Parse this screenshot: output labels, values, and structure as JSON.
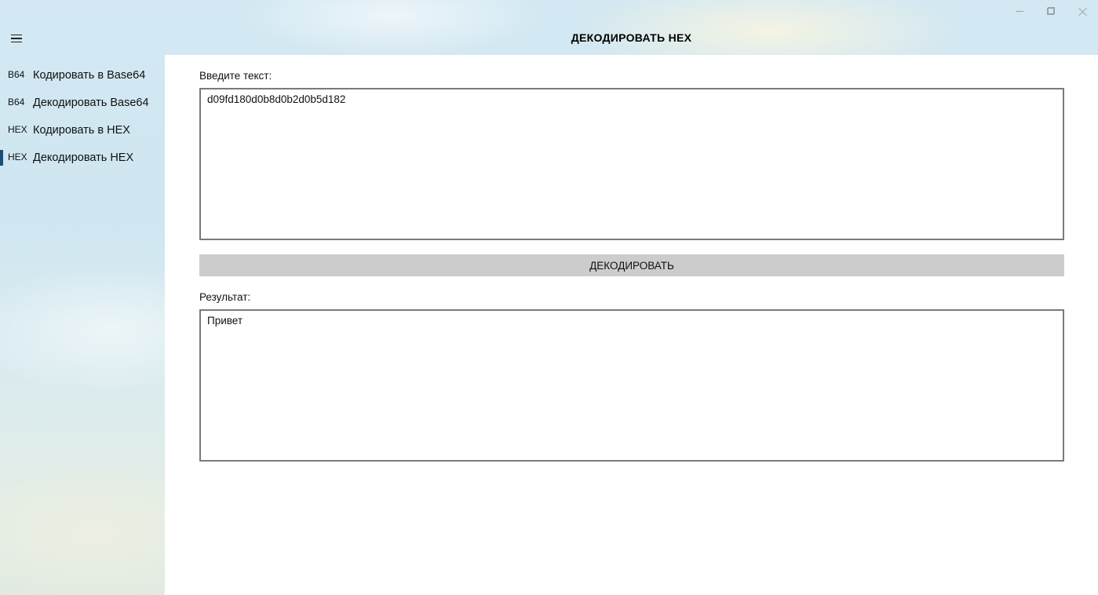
{
  "window": {
    "caption_buttons": [
      {
        "name": "minimize-icon"
      },
      {
        "name": "restore-icon"
      },
      {
        "name": "close-icon"
      }
    ]
  },
  "header": {
    "menu_icon": "hamburger-icon",
    "title": "ДЕКОДИРОВАТЬ HEX"
  },
  "sidebar": {
    "items": [
      {
        "badge": "B64",
        "label": "Кодировать в Base64",
        "selected": false
      },
      {
        "badge": "B64",
        "label": "Декодировать Base64",
        "selected": false
      },
      {
        "badge": "HEX",
        "label": "Кодировать в HEX",
        "selected": false
      },
      {
        "badge": "HEX",
        "label": "Декодировать HEX",
        "selected": true
      }
    ],
    "accent_color": "#1a4e7a"
  },
  "main": {
    "input_label": "Введите текст:",
    "input_value": "d09fd180d0b8d0b2d0b5d182",
    "decode_button": "ДЕКОДИРОВАТЬ",
    "result_label": "Результат:",
    "result_value": "Привет"
  }
}
